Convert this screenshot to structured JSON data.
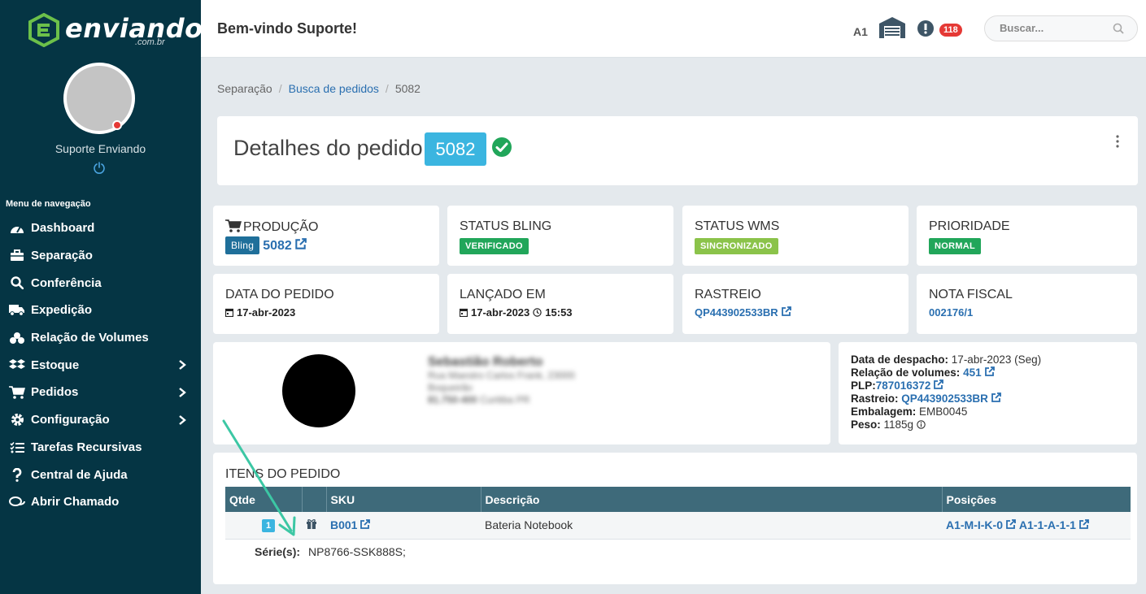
{
  "sidebar": {
    "logo": {
      "text": "enviando",
      "sub": ".com.br"
    },
    "user_name": "Suporte Enviando",
    "nav_title": "Menu de navegação",
    "items": [
      {
        "label": "Dashboard",
        "icon": "dashboard-icon",
        "chevron": false
      },
      {
        "label": "Separação",
        "icon": "briefcase-icon",
        "chevron": false
      },
      {
        "label": "Conferência",
        "icon": "search-icon",
        "chevron": false
      },
      {
        "label": "Expedição",
        "icon": "truck-icon",
        "chevron": false
      },
      {
        "label": "Relação de Volumes",
        "icon": "boxes-icon",
        "chevron": false
      },
      {
        "label": "Estoque",
        "icon": "dropbox-icon",
        "chevron": true
      },
      {
        "label": "Pedidos",
        "icon": "cart-icon",
        "chevron": true
      },
      {
        "label": "Configuração",
        "icon": "gear-icon",
        "chevron": true
      },
      {
        "label": "Tarefas Recursivas",
        "icon": "tasks-icon",
        "chevron": false
      },
      {
        "label": "Central de Ajuda",
        "icon": "question-icon",
        "chevron": false
      },
      {
        "label": "Abrir Chamado",
        "icon": "chat-icon",
        "chevron": false
      }
    ]
  },
  "header": {
    "welcome": "Bem-vindo Suporte!",
    "warehouse_code": "A1",
    "notification_count": "118",
    "search_placeholder": "Buscar..."
  },
  "breadcrumb": {
    "items": [
      "Separação",
      "Busca de pedidos",
      "5082"
    ]
  },
  "order": {
    "title": "Detalhes do pedido",
    "number": "5082"
  },
  "info_cards": {
    "producao": {
      "label": "PRODUÇÃO",
      "badge": "Bling",
      "value": "5082"
    },
    "status_bling": {
      "label": "STATUS BLING",
      "value": "VERIFICADO"
    },
    "status_wms": {
      "label": "STATUS WMS",
      "value": "SINCRONIZADO"
    },
    "prioridade": {
      "label": "PRIORIDADE",
      "value": "NORMAL"
    },
    "data_pedido": {
      "label": "DATA DO PEDIDO",
      "date": "17-abr-2023"
    },
    "lancado_em": {
      "label": "LANÇADO EM",
      "date": "17-abr-2023",
      "time": "15:53"
    },
    "rastreio": {
      "label": "RASTREIO",
      "value": "QP443902533BR"
    },
    "nota_fiscal": {
      "label": "NOTA FISCAL",
      "value": "002176/1"
    }
  },
  "customer": {
    "name": "Sebastião Roberto",
    "line1": "Rua Maestro Carlos Frank, 23000",
    "line2": "Boqueirão",
    "line3_bold": "81.750-400",
    "line3": "Curitiba PR"
  },
  "dispatch": {
    "data_label": "Data de despacho:",
    "data_value": "17-abr-2023 (Seg)",
    "volumes_label": "Relação de volumes:",
    "volumes_value": "451",
    "plp_label": "PLP:",
    "plp_value": "787016372",
    "rastreio_label": "Rastreio:",
    "rastreio_value": "QP443902533BR",
    "embalagem_label": "Embalagem:",
    "embalagem_value": "EMB0045",
    "peso_label": "Peso:",
    "peso_value": "1185g"
  },
  "items": {
    "title": "ITENS DO PEDIDO",
    "columns": [
      "Qtde",
      "",
      "SKU",
      "Descrição",
      "Posições"
    ],
    "row": {
      "qty": "1",
      "sku": "B001",
      "description": "Bateria Notebook",
      "position1": "A1-M-I-K-0",
      "position2": "A1-1-A-1-1"
    },
    "series_label": "Série(s):",
    "series_value": "NP8766-SSK888S;"
  },
  "colors": {
    "sidebar_bg": "#053544",
    "accent": "#3bb5e0",
    "link": "#2a6fb0",
    "verified": "#21a65a",
    "synced": "#8bc34a",
    "normal": "#21a65a",
    "bling_badge": "#1f6f9a",
    "table_header": "#3e6a7a",
    "arrow": "#3cc7a4"
  }
}
